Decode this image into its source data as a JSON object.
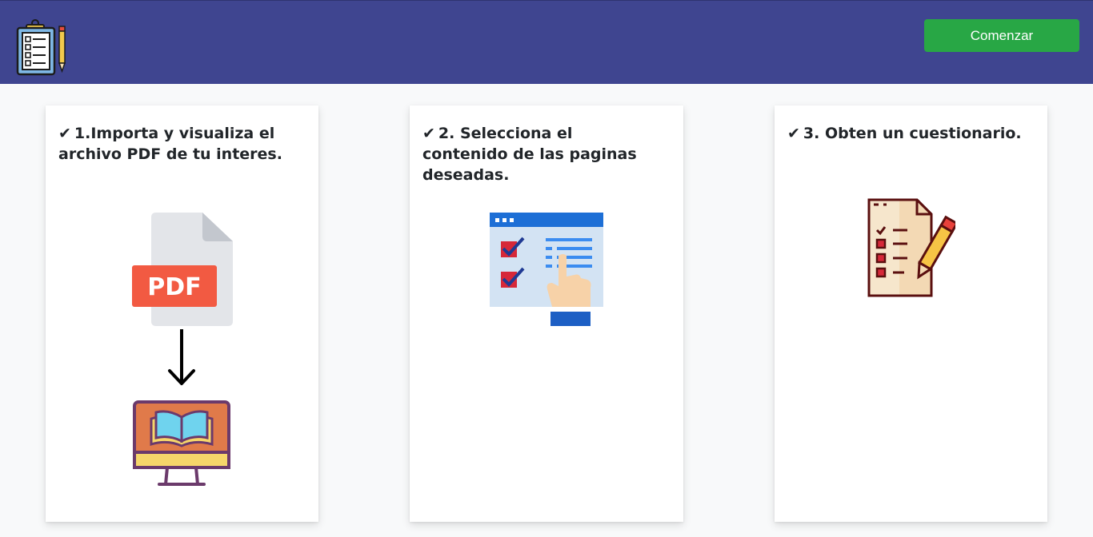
{
  "header": {
    "logo_icon": "clipboard-checklist-pencil-icon",
    "start_button_label": "Comenzar",
    "background_color": "#3f4590",
    "button_color": "#28a745"
  },
  "steps": [
    {
      "check_icon": "✔",
      "title": "1.Importa y visualiza el archivo PDF de tu interes.",
      "icons": [
        "pdf-file-icon",
        "arrow-down-icon",
        "monitor-book-icon"
      ],
      "pdf_badge_text": "PDF"
    },
    {
      "check_icon": "✔",
      "title": "2. Selecciona el contenido de las paginas deseadas.",
      "icons": [
        "select-content-hand-icon"
      ]
    },
    {
      "check_icon": "✔",
      "title": "3. Obten un cuestionario.",
      "icons": [
        "questionnaire-pencil-icon"
      ]
    }
  ]
}
